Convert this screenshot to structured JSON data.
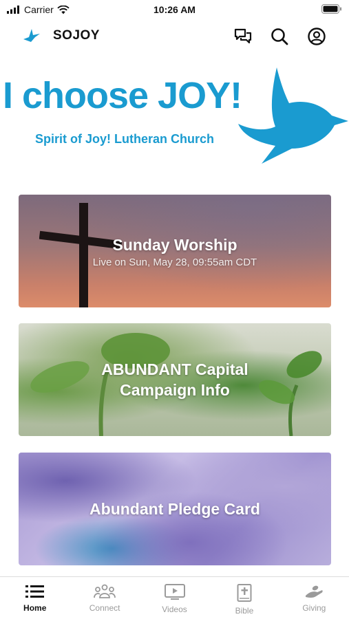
{
  "status_bar": {
    "carrier": "Carrier",
    "time": "10:26 AM"
  },
  "header": {
    "app_name": "SOJOY"
  },
  "hero": {
    "headline": "I choose JOY!",
    "subtitle": "Spirit of Joy! Lutheran Church"
  },
  "cards": [
    {
      "title": "Sunday Worship",
      "subtitle": "Live on Sun, May 28, 09:55am CDT"
    },
    {
      "title_line1": "ABUNDANT Capital",
      "title_line2": "Campaign Info"
    },
    {
      "title": "Abundant Pledge Card"
    }
  ],
  "tabs": [
    {
      "label": "Home",
      "icon": "list-icon",
      "active": true
    },
    {
      "label": "Connect",
      "icon": "people-icon",
      "active": false
    },
    {
      "label": "Videos",
      "icon": "tv-play-icon",
      "active": false
    },
    {
      "label": "Bible",
      "icon": "bible-icon",
      "active": false
    },
    {
      "label": "Giving",
      "icon": "giving-hand-icon",
      "active": false
    }
  ],
  "colors": {
    "brand_blue": "#1a9bd0",
    "tab_active": "#111111",
    "tab_inactive": "#9a9a9a"
  }
}
